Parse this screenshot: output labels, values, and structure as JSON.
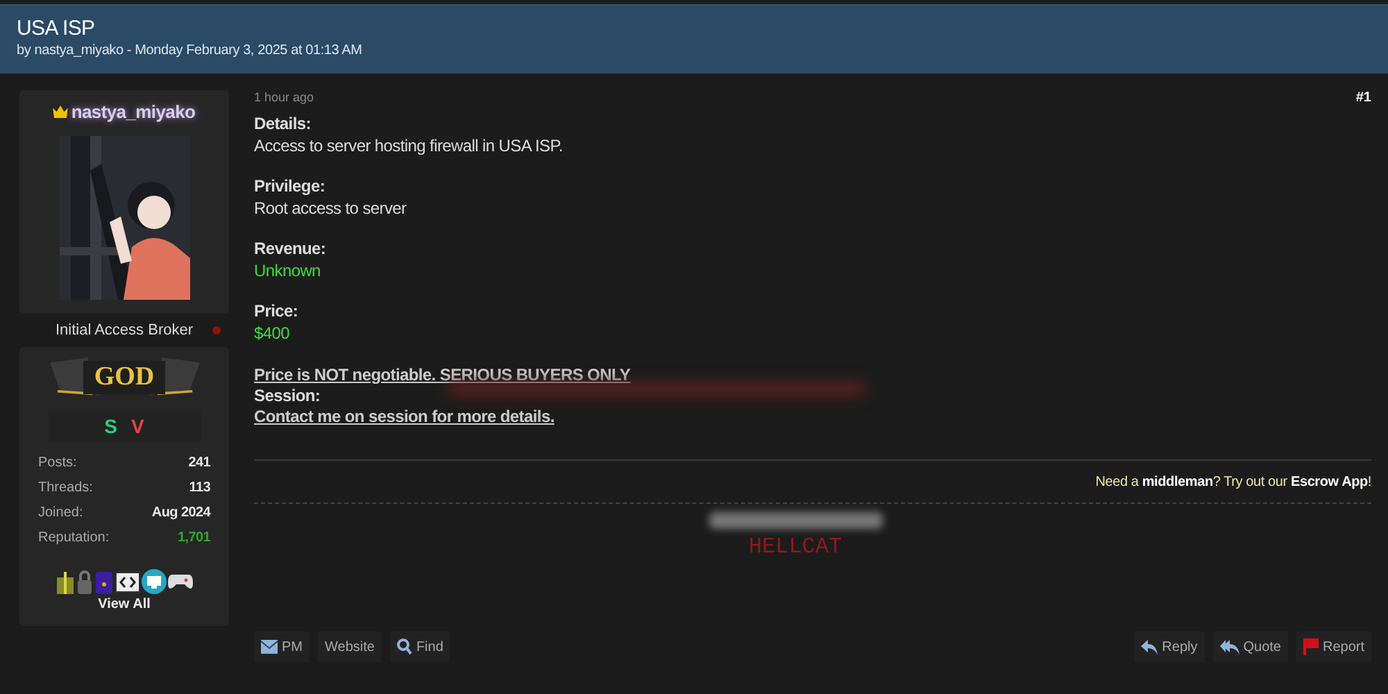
{
  "thread": {
    "title": "USA ISP",
    "byline": "by nastya_miyako - Monday February 3, 2025 at 01:13 AM"
  },
  "author": {
    "username": "nastya_miyako",
    "usertitle": "Initial Access Broker",
    "online": false,
    "rank": "GOD",
    "badges": [
      {
        "text": "S",
        "color": "#27d07a"
      },
      {
        "text": "V",
        "color": "#e04848"
      }
    ],
    "stats": [
      {
        "label": "Posts:",
        "value": "241",
        "color": "#e8e8e8"
      },
      {
        "label": "Threads:",
        "value": "113",
        "color": "#e8e8e8"
      },
      {
        "label": "Joined:",
        "value": "Aug 2024",
        "color": "#e8e8e8"
      },
      {
        "label": "Reputation:",
        "value": "1,701",
        "color": "#2fa82f"
      }
    ],
    "view_all": "View All"
  },
  "post": {
    "time": "1 hour ago",
    "number": "#1",
    "sections": [
      {
        "label": "Details:",
        "value": "Access to server hosting firewall in USA ISP.",
        "kind": "plain"
      },
      {
        "label": "Privilege:",
        "value": "Root access to server",
        "kind": "plain"
      },
      {
        "label": "Revenue:",
        "value": "Unknown",
        "kind": "green"
      },
      {
        "label": "Price:",
        "value": "$400",
        "kind": "green"
      }
    ],
    "notice": "Price is NOT negotiable. SERIOUS BUYERS ONLY",
    "session_label": "Session:",
    "contact": "Contact me on session for more details.",
    "escrow": "Need a **middleman**? Try out our **Escrow App**!",
    "signature": "HELLCAT"
  },
  "actions_left": [
    {
      "label": "PM",
      "kind": "mail"
    },
    {
      "label": "Website",
      "kind": "plain"
    },
    {
      "label": "Find",
      "kind": "search"
    }
  ],
  "actions_right": [
    {
      "label": "Reply",
      "kind": "reply"
    },
    {
      "label": "Quote",
      "kind": "quote"
    },
    {
      "label": "Report",
      "kind": "flag"
    }
  ]
}
